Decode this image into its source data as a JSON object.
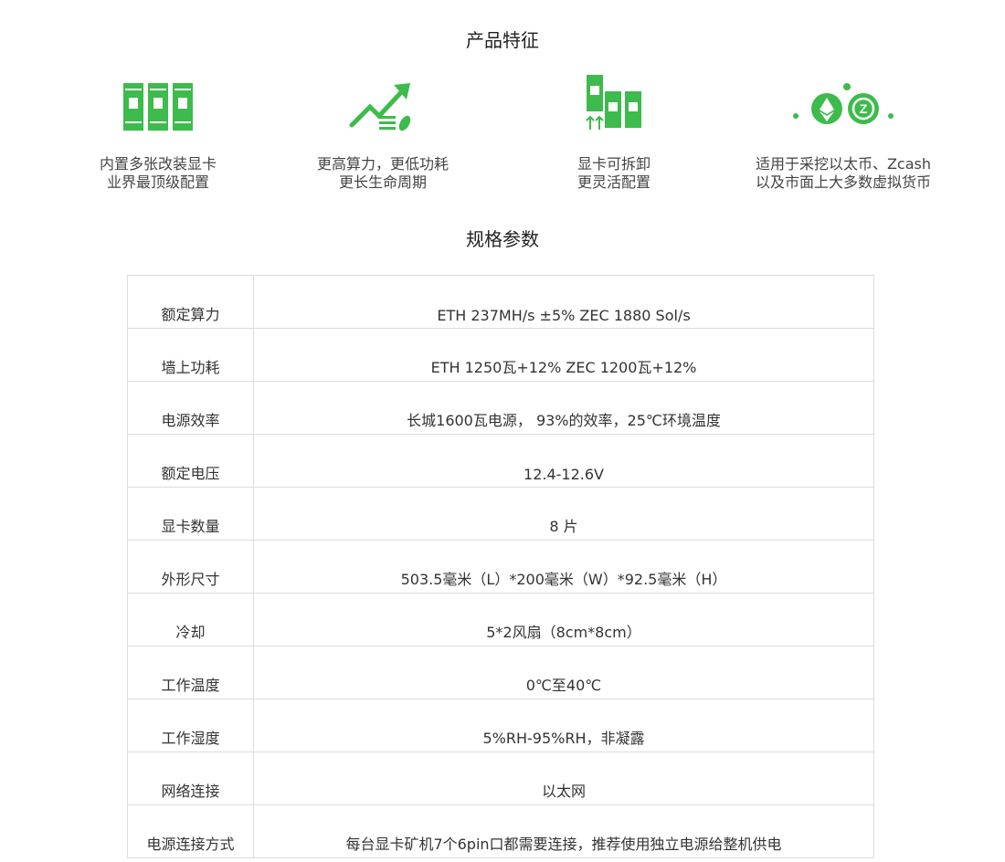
{
  "features_title": "产品特征",
  "specs_title": "规格参数",
  "accent_color": "#3dbb4c",
  "features": [
    {
      "icon": "gpu-cards-icon",
      "line1": "内置多张改装显卡",
      "line2": "业界最顶级配置"
    },
    {
      "icon": "trend-up-icon",
      "line1": "更高算力，更低功耗",
      "line2": "更长生命周期"
    },
    {
      "icon": "removable-card-icon",
      "line1": "显卡可拆卸",
      "line2": "更灵活配置"
    },
    {
      "icon": "crypto-coins-icon",
      "line1": "适用于采挖以太币、Zcash",
      "line2": "以及市面上大多数虚拟货币"
    }
  ],
  "specs": [
    {
      "label": "额定算力",
      "value": "ETH 237MH/s ±5% ZEC 1880 Sol/s"
    },
    {
      "label": "墙上功耗",
      "value": "ETH 1250瓦+12% ZEC 1200瓦+12%"
    },
    {
      "label": "电源效率",
      "value": "长城1600瓦电源， 93%的效率，25℃环境温度"
    },
    {
      "label": "额定电压",
      "value": "12.4-12.6V"
    },
    {
      "label": "显卡数量",
      "value": "8 片"
    },
    {
      "label": "外形尺寸",
      "value": "503.5毫米（L）*200毫米（W）*92.5毫米（H）"
    },
    {
      "label": "冷却",
      "value": "5*2风扇（8cm*8cm）"
    },
    {
      "label": "工作温度",
      "value": "0℃至40℃"
    },
    {
      "label": "工作湿度",
      "value": "5%RH-95%RH，非凝露"
    },
    {
      "label": "网络连接",
      "value": "以太网"
    },
    {
      "label": "电源连接方式",
      "value": "每台显卡矿机7个6pin口都需要连接，推荐使用独立电源给整机供电"
    }
  ]
}
